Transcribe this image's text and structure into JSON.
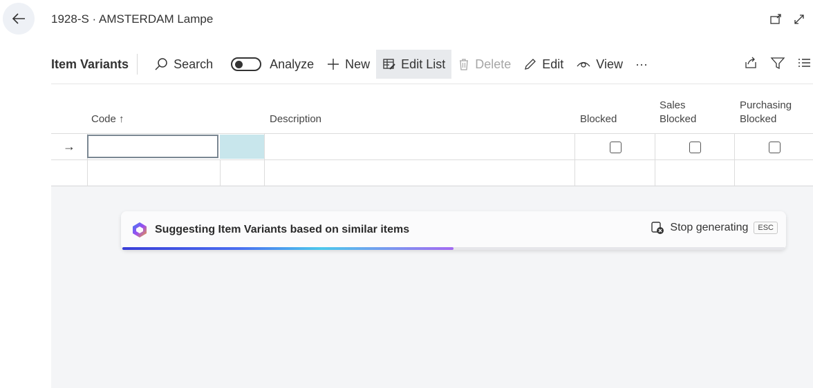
{
  "page": {
    "title": "1928-S · AMSTERDAM Lampe"
  },
  "actionbar": {
    "title": "Item Variants",
    "search": "Search",
    "analyze": "Analyze",
    "new": "New",
    "edit_list": "Edit List",
    "delete": "Delete",
    "edit": "Edit",
    "view": "View",
    "more": "···"
  },
  "columns": {
    "code": "Code ↑",
    "description": "Description",
    "blocked": "Blocked",
    "sales_blocked_1": "Sales",
    "sales_blocked_2": "Blocked",
    "purchasing_blocked_1": "Purchasing",
    "purchasing_blocked_2": "Blocked"
  },
  "row_indicator": "→",
  "banner": {
    "text": "Suggesting Item Variants based on similar items",
    "stop": "Stop generating",
    "esc": "ESC",
    "progress": 0.5
  }
}
